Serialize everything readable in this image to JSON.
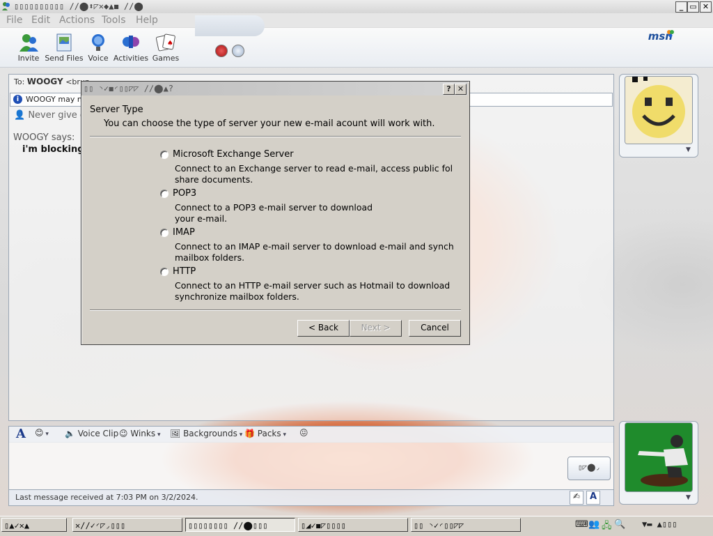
{
  "window": {
    "title": "▯▯▯▯▯▯▯▯▯▯ ∕∕⬤⬍◸✕◆▲◼ ∕∕⬤",
    "min_label": "_",
    "max_label": "▭",
    "close_label": "✕"
  },
  "menu": {
    "items": [
      "File",
      "Edit",
      "Actions",
      "Tools",
      "Help"
    ]
  },
  "toolbar": {
    "buttons": [
      "Invite",
      "Send Files",
      "Voice",
      "Activities",
      "Games"
    ],
    "logo": "msn"
  },
  "conversation": {
    "to_prefix": "To:",
    "to_name": "WOOGY",
    "to_email": "<brun...",
    "info": "WOOGY may no",
    "never_give": "Never give ou",
    "sender_says": "WOOGY says:",
    "message": "i'm blocking"
  },
  "dialog": {
    "title": "▯▯ ◝✓◼◜▯▯◸◸ ∕∕⬤▲?",
    "help_btn": "?",
    "close_btn": "✕",
    "header_title": "Server Type",
    "header_sub": "You can choose the type of server your new e-mail acount will work with.",
    "options": [
      {
        "label": "Microsoft Exchange Server",
        "desc": "Connect to an Exchange server to read e-mail, access public fol\nshare documents.",
        "selected": false
      },
      {
        "label": "POP3",
        "desc": "Connect to a POP3 e-mail server to download\nyour e-mail.",
        "selected": false
      },
      {
        "label": "IMAP",
        "desc": "Connect to an IMAP e-mail server to download e-mail and synch\nmailbox folders.",
        "selected": false
      },
      {
        "label": "HTTP",
        "desc": "Connect to an HTTP e-mail server such as Hotmail to download\nsynchronize mailbox folders.",
        "selected": false
      }
    ],
    "back": "< Back",
    "next": "Next >",
    "cancel": "Cancel"
  },
  "compose": {
    "font_icon": "A",
    "voice_clip": "Voice Clip",
    "winks": "Winks",
    "backgrounds": "Backgrounds",
    "packs": "Packs",
    "send_label": "▯◸⬤◞",
    "status": "Last message received at 7:03 PM on 3/2/2024."
  },
  "taskbar": {
    "start": "▯▲✓✕▲",
    "tasks": [
      "✕∕∕✓◜◸◞▯▯▯",
      "▯▯▯▯▯▯▯▯ ∕∕⬤▯▯▯",
      "▯◢✓◼◸▯▯▯▯",
      "▯▯ ◝✓◜▯▯◸◸"
    ],
    "clock": "▼▬ ▲▯▯▯"
  },
  "colors": {
    "msn_blue": "#1b4d9b",
    "dialog_gray": "#d4d0c8"
  }
}
